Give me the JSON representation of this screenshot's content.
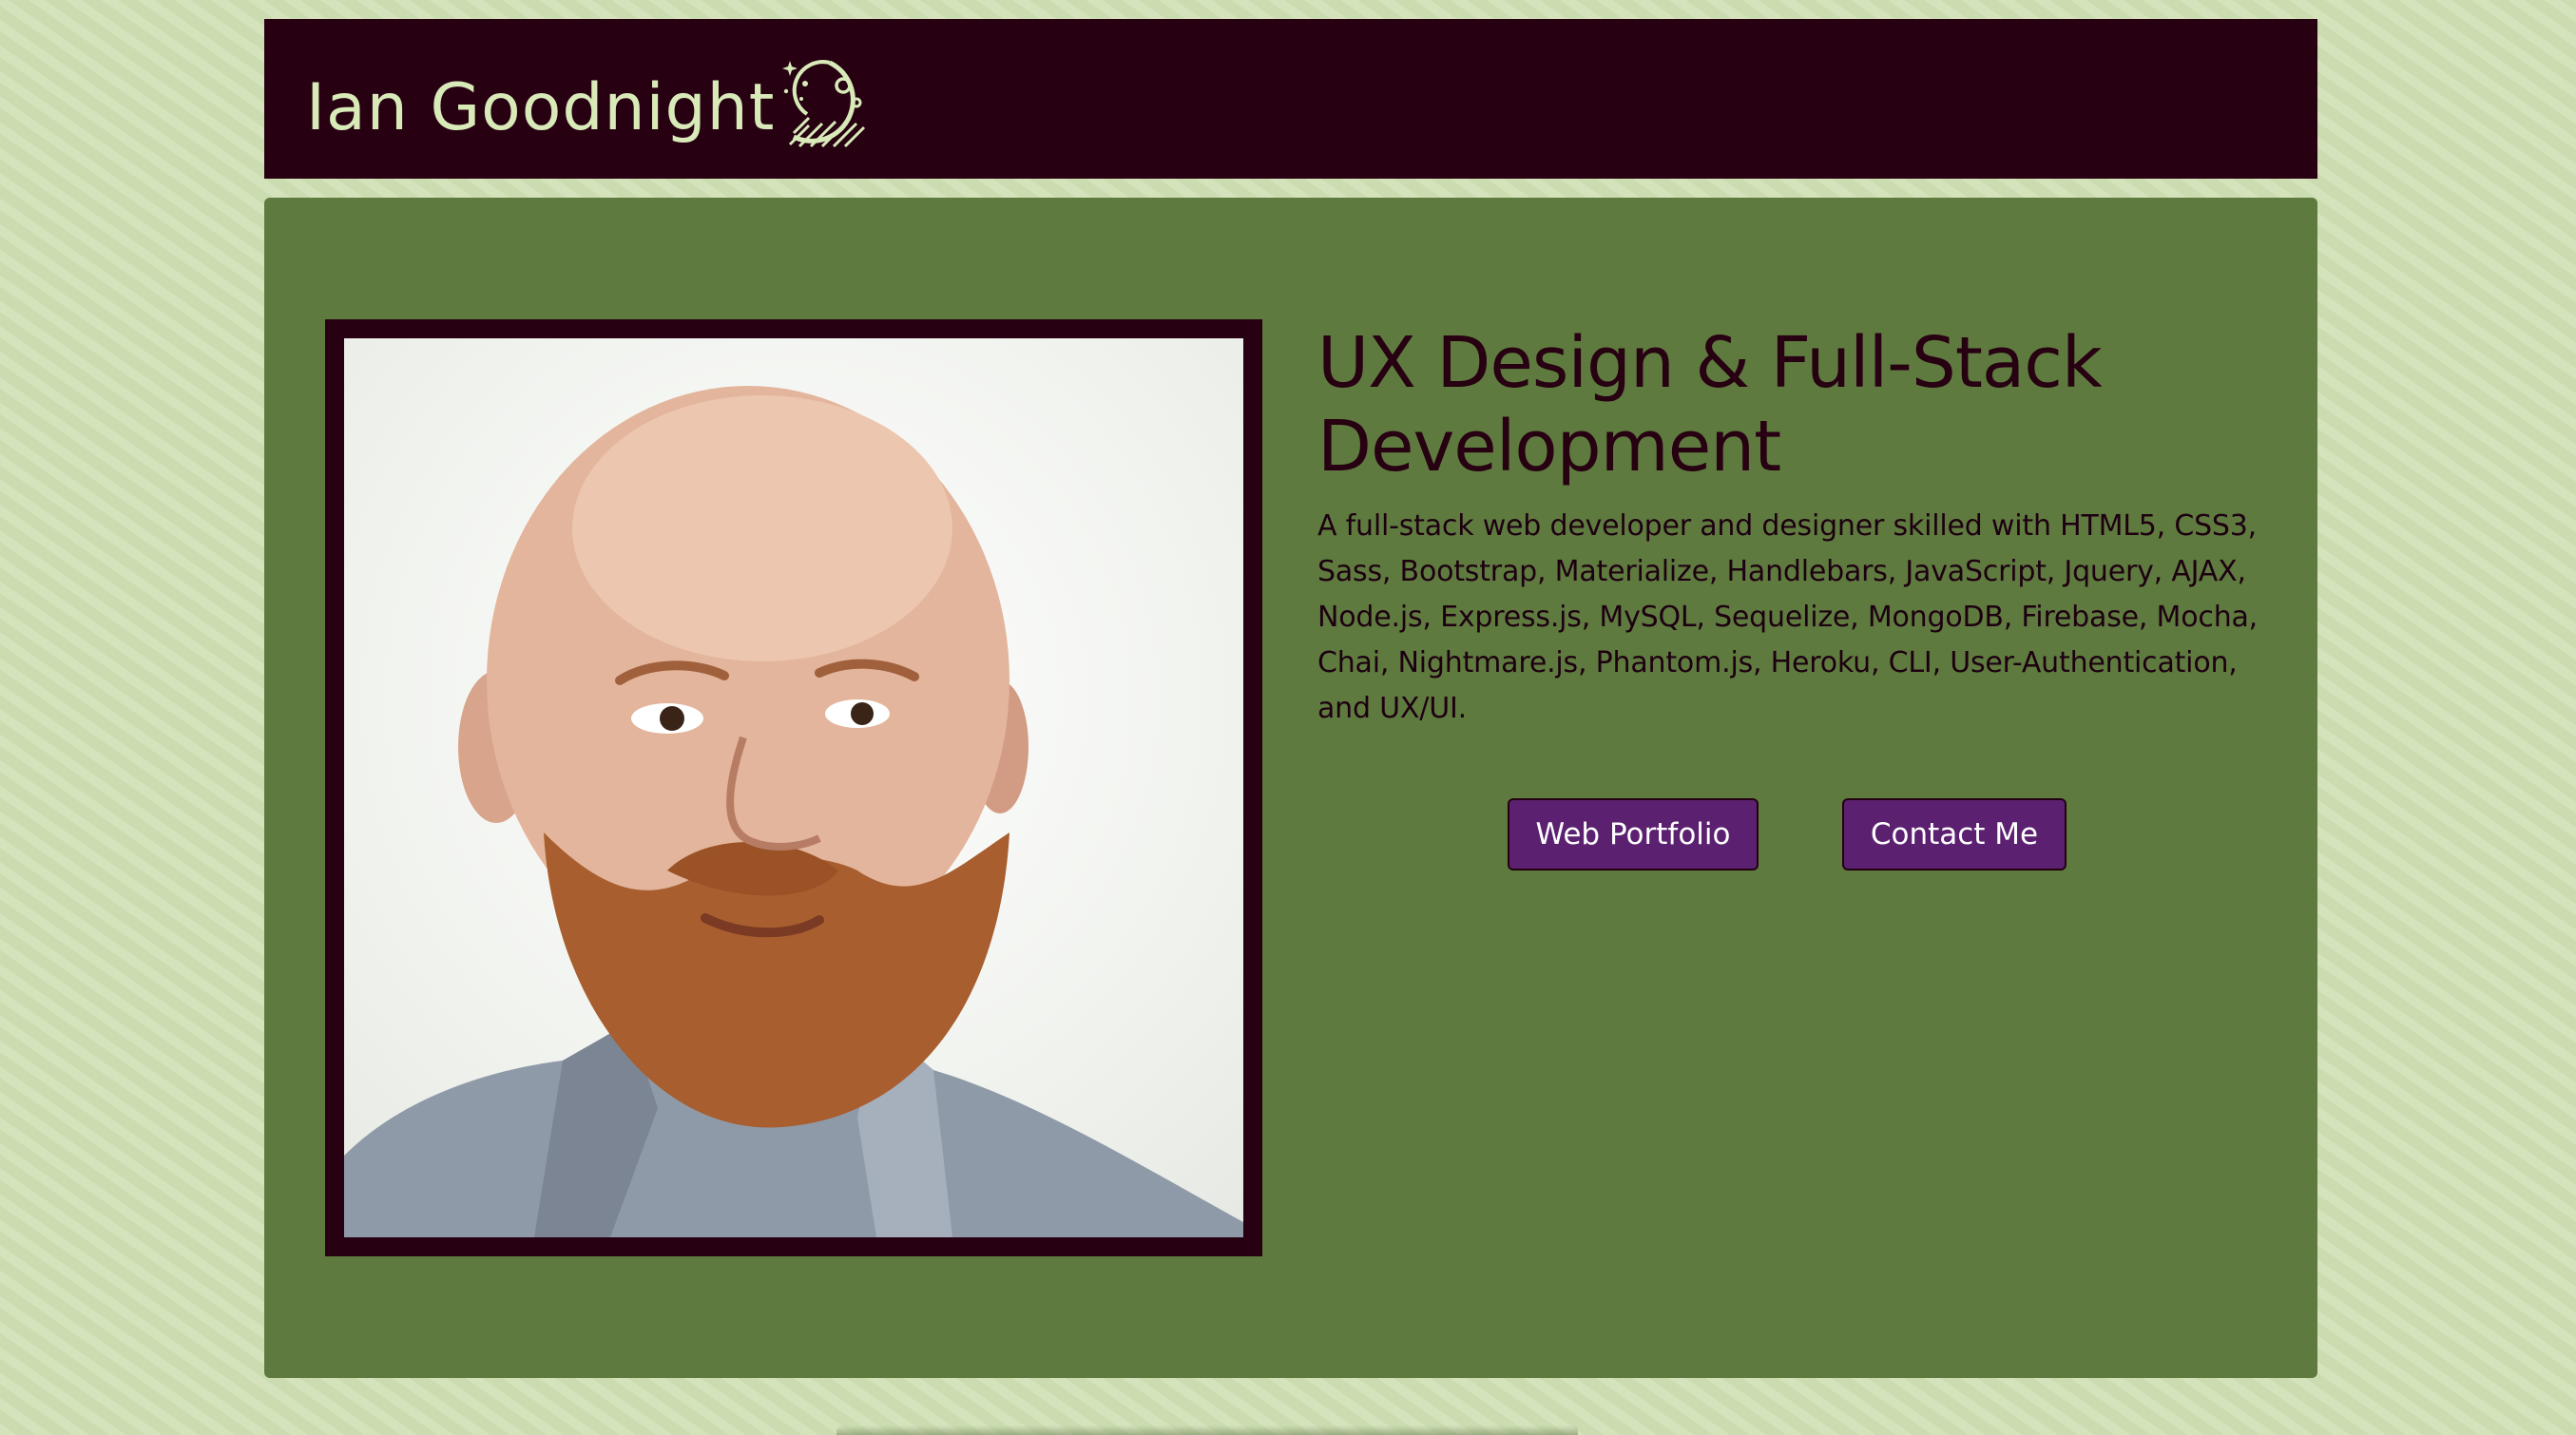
{
  "header": {
    "logo_text": "Ian Goodnight",
    "logo_icon": "moon-stars-icon"
  },
  "hero": {
    "title": "UX Design & Full-Stack Development",
    "description": "A full-stack web developer and designer skilled with HTML5, CSS3, Sass, Bootstrap, Materialize, Handlebars, JavaScript, Jquery, AJAX, Node.js, Express.js, MySQL, Sequelize, MongoDB, Firebase, Mocha, Chai, Nightmare.js, Phantom.js, Heroku, CLI, User-Authentication, and UX/UI.",
    "photo": "portrait-photo"
  },
  "buttons": {
    "portfolio_label": "Web Portfolio",
    "contact_label": "Contact Me"
  },
  "colors": {
    "page_background": "#cfe0b3",
    "header_background": "#270012",
    "panel_background": "#5e7a3f",
    "button_background": "#5b2170",
    "logo_text": "#d9eab9"
  }
}
